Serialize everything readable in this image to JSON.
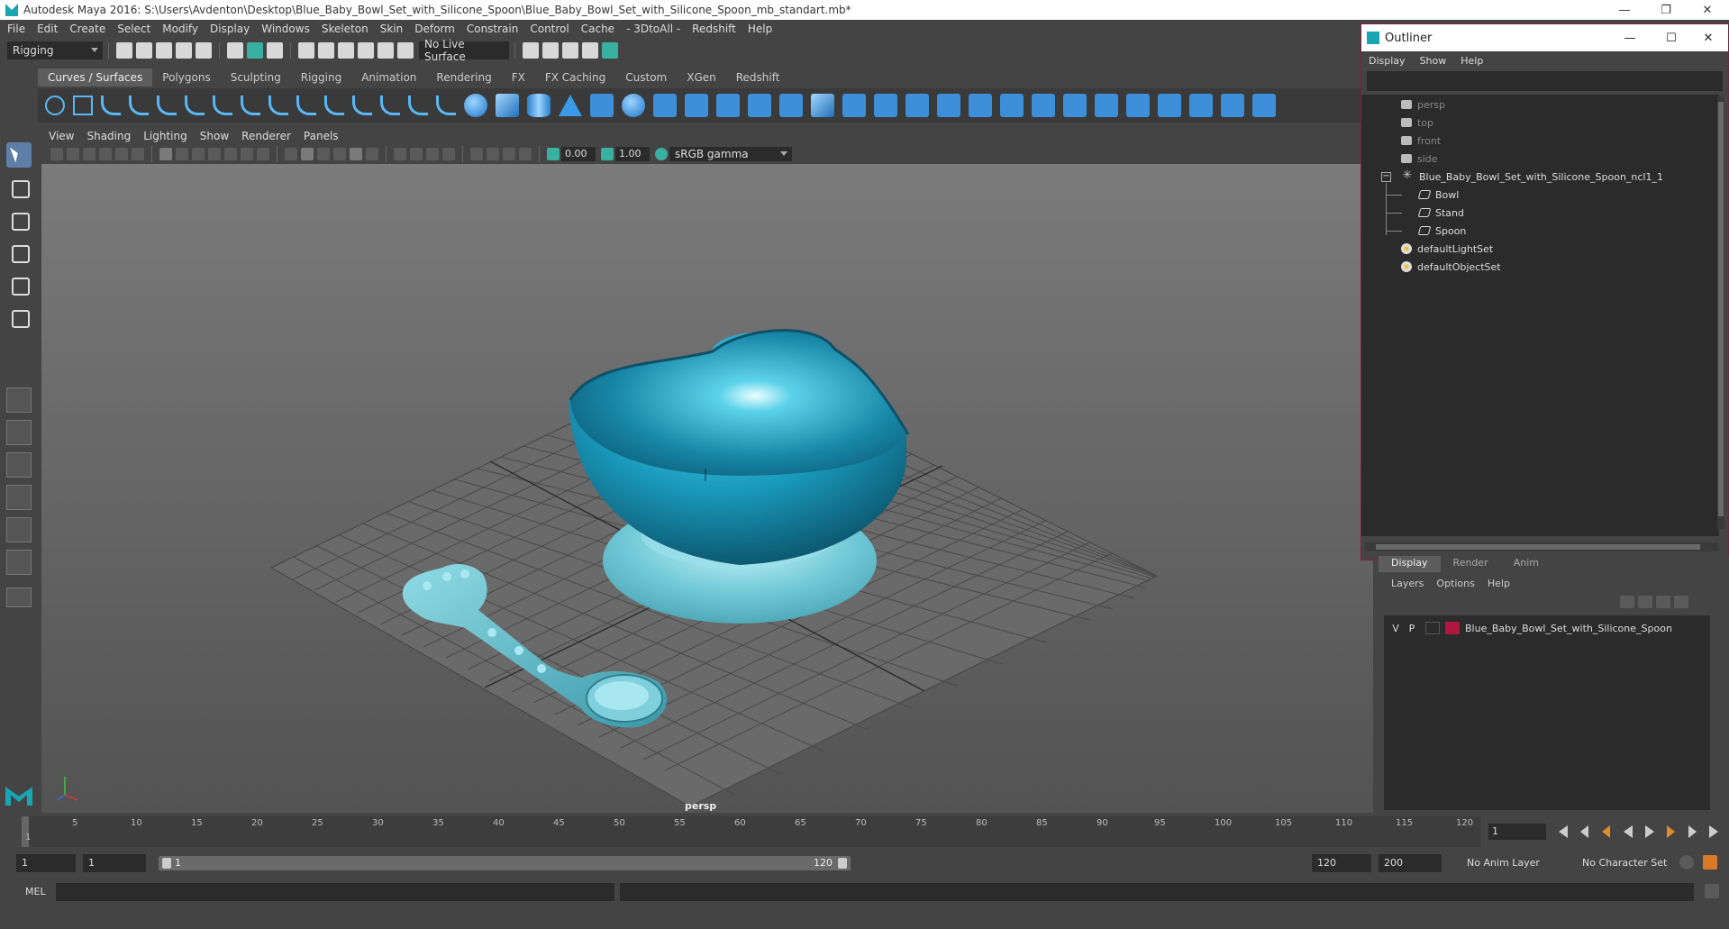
{
  "window": {
    "title": "Autodesk Maya 2016: S:\\Users\\Avdenton\\Desktop\\Blue_Baby_Bowl_Set_with_Silicone_Spoon\\Blue_Baby_Bowl_Set_with_Silicone_Spoon_mb_standart.mb*",
    "controls": [
      "—",
      "❐",
      "✕"
    ]
  },
  "menubar": [
    "File",
    "Edit",
    "Create",
    "Select",
    "Modify",
    "Display",
    "Windows",
    "Skeleton",
    "Skin",
    "Deform",
    "Constrain",
    "Control",
    "Cache",
    "- 3DtoAll -",
    "Redshift",
    "Help"
  ],
  "statusline": {
    "mode": "Rigging",
    "live_surface": "No Live Surface"
  },
  "shelf": {
    "tabs": [
      "Curves / Surfaces",
      "Polygons",
      "Sculpting",
      "Rigging",
      "Animation",
      "Rendering",
      "FX",
      "FX Caching",
      "Custom",
      "XGen",
      "Redshift"
    ],
    "active_tab": "Curves / Surfaces"
  },
  "panel": {
    "menus": [
      "View",
      "Shading",
      "Lighting",
      "Show",
      "Renderer",
      "Panels"
    ],
    "exposure": "0.00",
    "gamma": "1.00",
    "color_space": "sRGB gamma",
    "camera_label": "persp"
  },
  "outliner": {
    "title": "Outliner",
    "menus": [
      "Display",
      "Show",
      "Help"
    ],
    "items": [
      {
        "label": "persp"
      },
      {
        "label": "top"
      },
      {
        "label": "front"
      },
      {
        "label": "side"
      },
      {
        "label": "Blue_Baby_Bowl_Set_with_Silicone_Spoon_ncl1_1"
      },
      {
        "label": "Bowl"
      },
      {
        "label": "Stand"
      },
      {
        "label": "Spoon"
      },
      {
        "label": "defaultLightSet"
      },
      {
        "label": "defaultObjectSet"
      }
    ]
  },
  "layers": {
    "tabs": [
      "Display",
      "Render",
      "Anim"
    ],
    "active_tab": "Display",
    "menus": [
      "Layers",
      "Options",
      "Help"
    ],
    "rows": [
      {
        "v": "V",
        "p": "P",
        "name": "Blue_Baby_Bowl_Set_with_Silicone_Spoon",
        "color": "#b0163e"
      }
    ]
  },
  "timeslider": {
    "ticks": [
      "5",
      "10",
      "15",
      "20",
      "25",
      "30",
      "35",
      "40",
      "45",
      "50",
      "55",
      "60",
      "65",
      "70",
      "75",
      "80",
      "85",
      "90",
      "95",
      "100",
      "105",
      "110",
      "115",
      "120"
    ],
    "start_label": "1",
    "current_frame": "1"
  },
  "rangeslider": {
    "start": "1",
    "playback_start": "1",
    "range_start": "1",
    "range_end": "120",
    "playback_end": "120",
    "end": "200",
    "anim_layer": "No Anim Layer",
    "character_set": "No Character Set"
  },
  "cmdline": {
    "label": "MEL"
  }
}
